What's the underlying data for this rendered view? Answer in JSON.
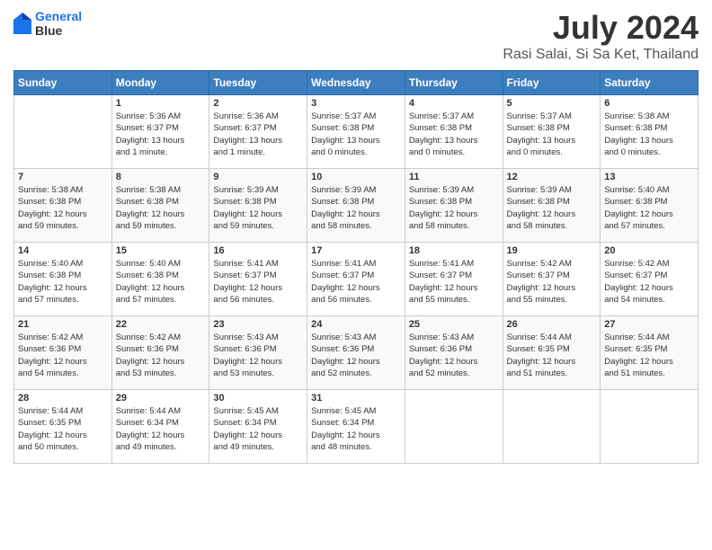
{
  "header": {
    "logo_line1": "General",
    "logo_line2": "Blue",
    "main_title": "July 2024",
    "subtitle": "Rasi Salai, Si Sa Ket, Thailand"
  },
  "calendar": {
    "days_of_week": [
      "Sunday",
      "Monday",
      "Tuesday",
      "Wednesday",
      "Thursday",
      "Friday",
      "Saturday"
    ],
    "weeks": [
      [
        {
          "day": "",
          "info": ""
        },
        {
          "day": "1",
          "info": "Sunrise: 5:36 AM\nSunset: 6:37 PM\nDaylight: 13 hours\nand 1 minute."
        },
        {
          "day": "2",
          "info": "Sunrise: 5:36 AM\nSunset: 6:37 PM\nDaylight: 13 hours\nand 1 minute."
        },
        {
          "day": "3",
          "info": "Sunrise: 5:37 AM\nSunset: 6:38 PM\nDaylight: 13 hours\nand 0 minutes."
        },
        {
          "day": "4",
          "info": "Sunrise: 5:37 AM\nSunset: 6:38 PM\nDaylight: 13 hours\nand 0 minutes."
        },
        {
          "day": "5",
          "info": "Sunrise: 5:37 AM\nSunset: 6:38 PM\nDaylight: 13 hours\nand 0 minutes."
        },
        {
          "day": "6",
          "info": "Sunrise: 5:38 AM\nSunset: 6:38 PM\nDaylight: 13 hours\nand 0 minutes."
        }
      ],
      [
        {
          "day": "7",
          "info": "Sunrise: 5:38 AM\nSunset: 6:38 PM\nDaylight: 12 hours\nand 59 minutes."
        },
        {
          "day": "8",
          "info": "Sunrise: 5:38 AM\nSunset: 6:38 PM\nDaylight: 12 hours\nand 59 minutes."
        },
        {
          "day": "9",
          "info": "Sunrise: 5:39 AM\nSunset: 6:38 PM\nDaylight: 12 hours\nand 59 minutes."
        },
        {
          "day": "10",
          "info": "Sunrise: 5:39 AM\nSunset: 6:38 PM\nDaylight: 12 hours\nand 58 minutes."
        },
        {
          "day": "11",
          "info": "Sunrise: 5:39 AM\nSunset: 6:38 PM\nDaylight: 12 hours\nand 58 minutes."
        },
        {
          "day": "12",
          "info": "Sunrise: 5:39 AM\nSunset: 6:38 PM\nDaylight: 12 hours\nand 58 minutes."
        },
        {
          "day": "13",
          "info": "Sunrise: 5:40 AM\nSunset: 6:38 PM\nDaylight: 12 hours\nand 57 minutes."
        }
      ],
      [
        {
          "day": "14",
          "info": "Sunrise: 5:40 AM\nSunset: 6:38 PM\nDaylight: 12 hours\nand 57 minutes."
        },
        {
          "day": "15",
          "info": "Sunrise: 5:40 AM\nSunset: 6:38 PM\nDaylight: 12 hours\nand 57 minutes."
        },
        {
          "day": "16",
          "info": "Sunrise: 5:41 AM\nSunset: 6:37 PM\nDaylight: 12 hours\nand 56 minutes."
        },
        {
          "day": "17",
          "info": "Sunrise: 5:41 AM\nSunset: 6:37 PM\nDaylight: 12 hours\nand 56 minutes."
        },
        {
          "day": "18",
          "info": "Sunrise: 5:41 AM\nSunset: 6:37 PM\nDaylight: 12 hours\nand 55 minutes."
        },
        {
          "day": "19",
          "info": "Sunrise: 5:42 AM\nSunset: 6:37 PM\nDaylight: 12 hours\nand 55 minutes."
        },
        {
          "day": "20",
          "info": "Sunrise: 5:42 AM\nSunset: 6:37 PM\nDaylight: 12 hours\nand 54 minutes."
        }
      ],
      [
        {
          "day": "21",
          "info": "Sunrise: 5:42 AM\nSunset: 6:36 PM\nDaylight: 12 hours\nand 54 minutes."
        },
        {
          "day": "22",
          "info": "Sunrise: 5:42 AM\nSunset: 6:36 PM\nDaylight: 12 hours\nand 53 minutes."
        },
        {
          "day": "23",
          "info": "Sunrise: 5:43 AM\nSunset: 6:36 PM\nDaylight: 12 hours\nand 53 minutes."
        },
        {
          "day": "24",
          "info": "Sunrise: 5:43 AM\nSunset: 6:36 PM\nDaylight: 12 hours\nand 52 minutes."
        },
        {
          "day": "25",
          "info": "Sunrise: 5:43 AM\nSunset: 6:36 PM\nDaylight: 12 hours\nand 52 minutes."
        },
        {
          "day": "26",
          "info": "Sunrise: 5:44 AM\nSunset: 6:35 PM\nDaylight: 12 hours\nand 51 minutes."
        },
        {
          "day": "27",
          "info": "Sunrise: 5:44 AM\nSunset: 6:35 PM\nDaylight: 12 hours\nand 51 minutes."
        }
      ],
      [
        {
          "day": "28",
          "info": "Sunrise: 5:44 AM\nSunset: 6:35 PM\nDaylight: 12 hours\nand 50 minutes."
        },
        {
          "day": "29",
          "info": "Sunrise: 5:44 AM\nSunset: 6:34 PM\nDaylight: 12 hours\nand 49 minutes."
        },
        {
          "day": "30",
          "info": "Sunrise: 5:45 AM\nSunset: 6:34 PM\nDaylight: 12 hours\nand 49 minutes."
        },
        {
          "day": "31",
          "info": "Sunrise: 5:45 AM\nSunset: 6:34 PM\nDaylight: 12 hours\nand 48 minutes."
        },
        {
          "day": "",
          "info": ""
        },
        {
          "day": "",
          "info": ""
        },
        {
          "day": "",
          "info": ""
        }
      ]
    ]
  }
}
